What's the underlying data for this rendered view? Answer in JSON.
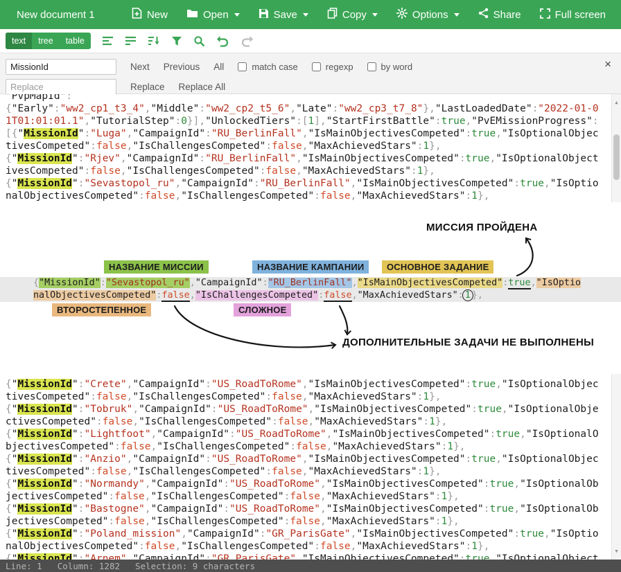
{
  "colors": {
    "header_green": "#3aa655",
    "mode_active_green": "#2e8743",
    "match_highlight": "#d9e54e",
    "key_dark": "#1d1d1d",
    "string_red": "#b5321f",
    "true_green": "#2c8a3a",
    "false_red": "#cf4b28",
    "number_green": "#2c8a3a",
    "annotation_green": "#8cc24a",
    "annotation_blue": "#7fb2dd",
    "annotation_yellow": "#e2c455",
    "annotation_tan": "#e9b87e",
    "annotation_pink": "#e3a2dc",
    "statusbar_gray": "#4e4e4e"
  },
  "titlebar": {
    "title": "New document 1",
    "menu": [
      {
        "label": "New"
      },
      {
        "label": "Open",
        "dropdown": true
      },
      {
        "label": "Save",
        "dropdown": true
      },
      {
        "label": "Copy",
        "dropdown": true
      },
      {
        "label": "Options",
        "dropdown": true
      },
      {
        "label": "Share"
      },
      {
        "label": "Full screen"
      }
    ]
  },
  "toolbar": {
    "modes": [
      "text",
      "tree",
      "table"
    ],
    "active_mode": "text",
    "icons": [
      "format",
      "compact",
      "sort",
      "filter",
      "search",
      "undo",
      "redo"
    ]
  },
  "search": {
    "query": "MissionId",
    "replace_placeholder": "Replace",
    "next_label": "Next",
    "previous_label": "Previous",
    "all_label": "All",
    "match_case_label": "match case",
    "regexp_label": "regexp",
    "by_word_label": "by word",
    "replace_label": "Replace",
    "replace_all_label": "Replace All",
    "close_label": "×"
  },
  "editor": {
    "wrap_width": 98,
    "clipped_line_tokens": [
      [
        "k",
        "\"PvpMapId\""
      ],
      [
        "p",
        ":"
      ]
    ],
    "preamble_tokens": [
      [
        "p",
        "{"
      ],
      [
        "k",
        "\"Early\""
      ],
      [
        "p",
        ":"
      ],
      [
        "s",
        "\"ww2_cp1_t3_4\""
      ],
      [
        "p",
        ","
      ],
      [
        "k",
        "\"Middle\""
      ],
      [
        "p",
        ":"
      ],
      [
        "s",
        "\"ww2_cp2_t5_6\""
      ],
      [
        "p",
        ","
      ],
      [
        "k",
        "\"Late\""
      ],
      [
        "p",
        ":"
      ],
      [
        "s",
        "\"ww2_cp3_t7_8\""
      ],
      [
        "p",
        "},"
      ],
      [
        "k",
        "\"LastLoadedDate\""
      ],
      [
        "p",
        ":"
      ],
      [
        "s",
        "\"2022-01-01T01:01:01.1\""
      ],
      [
        "p",
        ","
      ],
      [
        "k",
        "\"TutorialStep\""
      ],
      [
        "p",
        ":"
      ],
      [
        "n",
        "0"
      ],
      [
        "p",
        "}],"
      ],
      [
        "k",
        "\"UnlockedTiers\""
      ],
      [
        "p",
        ":["
      ],
      [
        "n",
        "1"
      ],
      [
        "p",
        "],"
      ],
      [
        "k",
        "\"StartFirstBattle\""
      ],
      [
        "p",
        ":"
      ],
      [
        "t",
        "true"
      ],
      [
        "p",
        ","
      ],
      [
        "k",
        "\"PvEMissionProgress\""
      ],
      [
        "p",
        ":"
      ]
    ],
    "fields": {
      "mission_key": "MissionId",
      "campaign_key": "CampaignId",
      "main_key": "IsMainObjectivesCompeted",
      "optional_key": "IsOptionalObjectivesCompeted",
      "challenge_key": "IsChallengesCompeted",
      "stars_key": "MaxAchievedStars"
    },
    "missions_top": [
      {
        "id": "Luga",
        "campaign": "RU_BerlinFall",
        "lead": "[{"
      },
      {
        "id": "Rjev",
        "campaign": "RU_BerlinFall"
      },
      {
        "id": "Sevastopol_ru",
        "campaign": "RU_BerlinFall"
      }
    ],
    "missions_bottom": [
      {
        "id": "Crete",
        "campaign": "US_RoadToRome"
      },
      {
        "id": "Tobruk",
        "campaign": "US_RoadToRome"
      },
      {
        "id": "Lightfoot",
        "campaign": "US_RoadToRome"
      },
      {
        "id": "Anzio",
        "campaign": "US_RoadToRome"
      },
      {
        "id": "Normandy",
        "campaign": "US_RoadToRome"
      },
      {
        "id": "Bastogne",
        "campaign": "US_RoadToRome"
      },
      {
        "id": "Poland_mission",
        "campaign": "GR_ParisGate"
      },
      {
        "id": "Arnem",
        "campaign": "GR_ParisGate"
      }
    ]
  },
  "annotation": {
    "mission_passed": "МИССИЯ ПРОЙДЕНА",
    "mission_name": "НАЗВАНИЕ МИССИИ",
    "campaign_name": "НАЗВАНИЕ КАМПАНИИ",
    "main_task": "ОСНОВНОЕ ЗАДАНИЕ",
    "secondary": "ВТОРОСТЕПЕННОЕ",
    "challenge": "СЛОЖНОЕ",
    "optional_not_done": "ДОПОЛНИТЕЛЬНЫЕ ЗАДАЧИ НЕ ВЫПОЛНЕНЫ",
    "line1": [
      [
        "p",
        "{"
      ],
      [
        "kg",
        "\"MissionId\""
      ],
      [
        "p",
        ":"
      ],
      [
        "sg",
        "\"Sevastopol_ru\""
      ],
      [
        "p",
        ","
      ],
      [
        "k",
        "\"CampaignId\""
      ],
      [
        "p",
        ":"
      ],
      [
        "sb",
        "\"RU_BerlinFall\""
      ],
      [
        "p",
        ","
      ],
      [
        "ky",
        "\"IsMainObjectivesCompeted\""
      ],
      [
        "p",
        ":"
      ],
      [
        "tu",
        "true"
      ],
      [
        "p",
        ","
      ],
      [
        "ko",
        "\"IsOptio"
      ]
    ],
    "line2": [
      [
        "ko",
        "nalObjectivesCompeted\""
      ],
      [
        "p",
        ":"
      ],
      [
        "fu",
        "false"
      ],
      [
        "p",
        ","
      ],
      [
        "kp",
        "\"IsChallengesCompeted\""
      ],
      [
        "p",
        ":"
      ],
      [
        "fu",
        "false"
      ],
      [
        "p",
        ","
      ],
      [
        "k",
        "\"MaxAchievedStars\""
      ],
      [
        "p",
        ":"
      ],
      [
        "nc",
        "1"
      ],
      [
        "p",
        "},"
      ]
    ]
  },
  "statusbar": {
    "segments": [
      "Line: 1",
      "Column: 1282",
      "Selection: 9 characters"
    ]
  }
}
